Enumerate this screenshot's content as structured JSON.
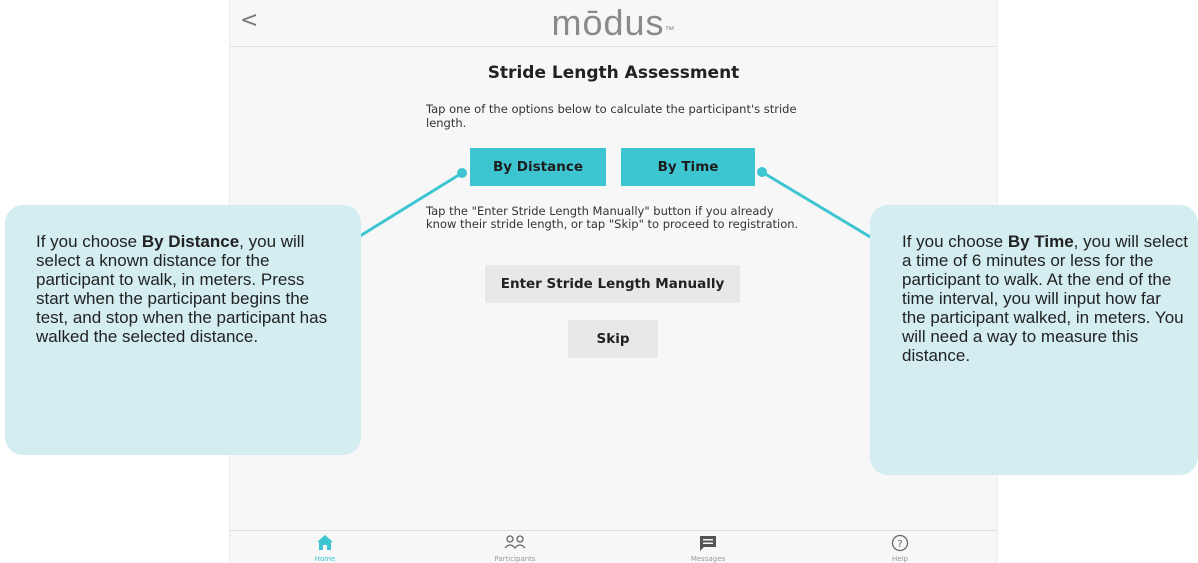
{
  "header": {
    "back": "<",
    "logo": "mōdus",
    "logo_tm": "™"
  },
  "page": {
    "title": "Stride Length Assessment",
    "intro": "Tap one of the options below to calculate the participant's stride length.",
    "by_distance": "By Distance",
    "by_time": "By Time",
    "instruction": "Tap the \"Enter Stride Length Manually\" button if you already know their stride length, or tap \"Skip\" to proceed to registration.",
    "manual": "Enter Stride Length Manually",
    "skip": "Skip"
  },
  "tabs": [
    {
      "label": "Home",
      "icon": "home-icon"
    },
    {
      "label": "Participants",
      "icon": "participants-icon"
    },
    {
      "label": "Messages",
      "icon": "messages-icon"
    },
    {
      "label": "Help",
      "icon": "help-icon"
    }
  ],
  "callouts": {
    "left": {
      "pre": "If you choose ",
      "bold": "By Distance",
      "post": ", you will select a known distance for the participant to walk, in meters. Press start when the participant begins the test, and stop when the participant has walked the selected distance."
    },
    "right": {
      "pre": "If you choose ",
      "bold": "By Time",
      "post": ", you will select a time of 6 minutes or less for the participant to walk. At the end of the time interval, you will input how far the participant walked, in meters. You will need a way to measure this distance."
    }
  },
  "colors": {
    "accent": "#3ec5d2",
    "callout_bg": "#d3edf0",
    "button_gray": "#e8e8e8"
  }
}
